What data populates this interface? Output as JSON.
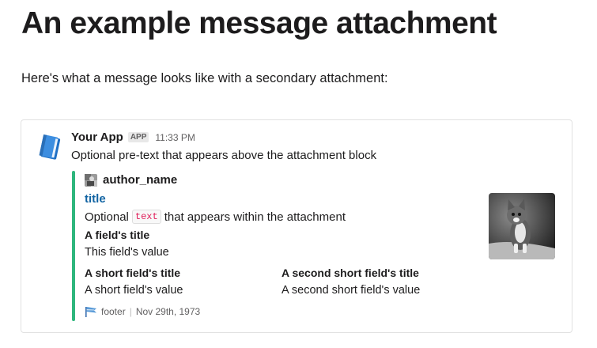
{
  "page": {
    "heading": "An example message attachment",
    "intro": "Here's what a message looks like with a secondary attachment:"
  },
  "message": {
    "app_name": "Your App",
    "app_badge": "APP",
    "timestamp": "11:33 PM",
    "pretext": "Optional pre-text that appears above the attachment block",
    "avatar_icon": "notebook-icon"
  },
  "attachment": {
    "accent_color": "#2eb67d",
    "author_icon": "author-avatar-icon",
    "author_name": "author_name",
    "title": "title",
    "text_before": "Optional",
    "text_code": "text",
    "text_after": "that appears within the attachment",
    "fields": [
      {
        "title": "A field's title",
        "value": "This field's value"
      },
      {
        "title": "A short field's title",
        "value": "A short field's value"
      },
      {
        "title": "A second short field's title",
        "value": "A second short field's value"
      }
    ],
    "thumb": "cat-photo",
    "footer_icon": "footer-flag-icon",
    "footer": "footer",
    "footer_date": "Nov 29th, 1973"
  }
}
